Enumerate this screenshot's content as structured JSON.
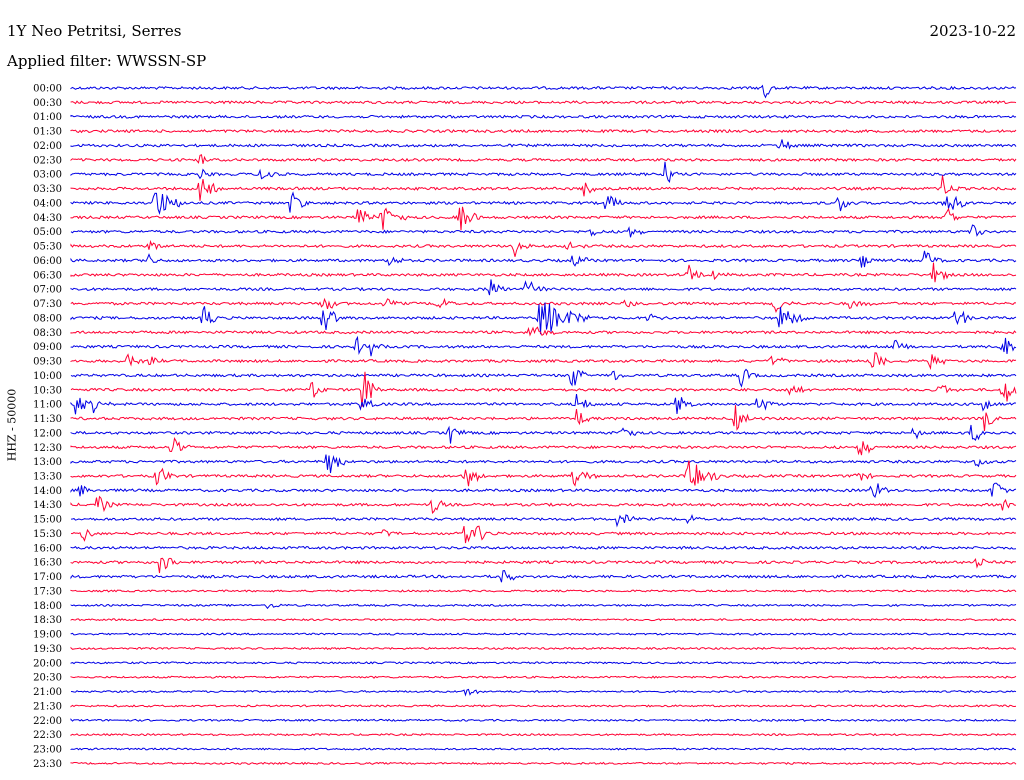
{
  "header": {
    "station": "1Y Neo Petritsi, Serres",
    "date": "2023-10-22",
    "filter": "Applied filter: WWSSN-SP"
  },
  "chart_data": {
    "type": "line",
    "title": "1Y Neo Petritsi, Serres",
    "ylabel": "HHZ - 50000",
    "row_labels": [
      "00:00",
      "00:30",
      "01:00",
      "01:30",
      "02:00",
      "02:30",
      "03:00",
      "03:30",
      "04:00",
      "04:30",
      "05:00",
      "05:30",
      "06:00",
      "06:30",
      "07:00",
      "07:30",
      "08:00",
      "08:30",
      "09:00",
      "09:30",
      "10:00",
      "10:30",
      "11:00",
      "11:30",
      "12:00",
      "12:30",
      "13:00",
      "13:30",
      "14:00",
      "14:30",
      "15:00",
      "15:30",
      "16:00",
      "16:30",
      "17:00",
      "17:30",
      "18:00",
      "18:30",
      "19:00",
      "19:30",
      "20:00",
      "20:30",
      "21:00",
      "21:30",
      "22:00",
      "22:30",
      "23:00",
      "23:30"
    ],
    "series_colors": [
      "#0000e6",
      "#ff0033"
    ],
    "grid": false
  }
}
